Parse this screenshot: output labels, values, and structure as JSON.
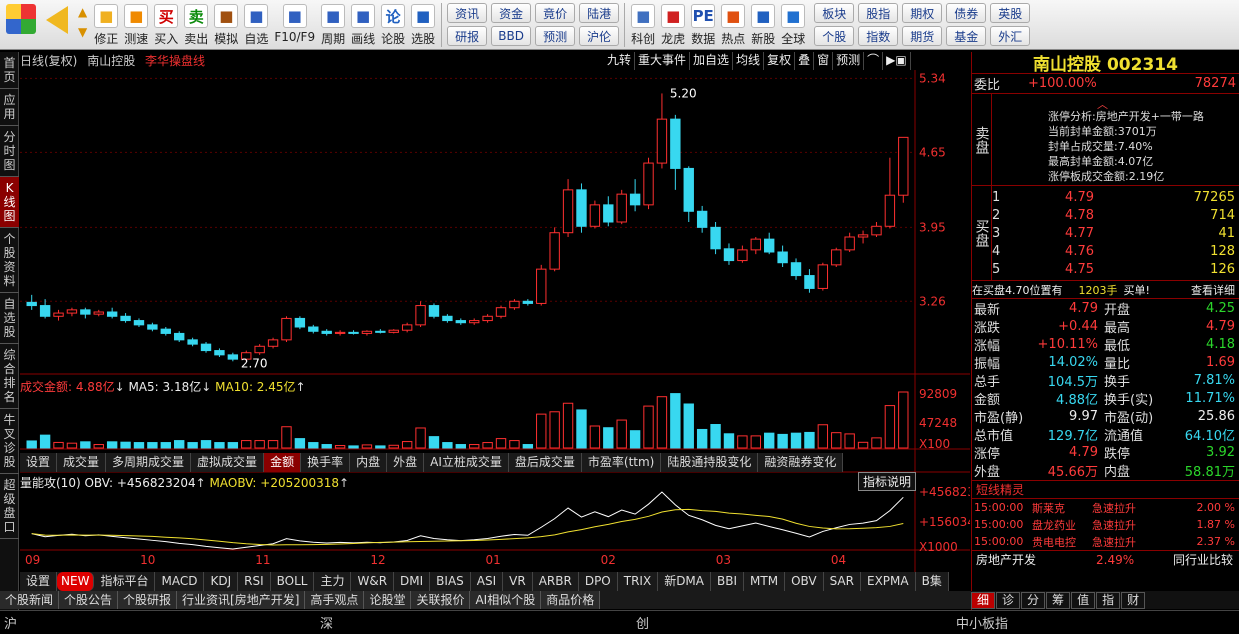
{
  "toolbar": {
    "buttons": [
      {
        "label": "修正",
        "icon": "refresh-icon",
        "color": "#f0b020"
      },
      {
        "label": "测速",
        "icon": "clock-icon",
        "color": "#f08a00"
      },
      {
        "label": "买入",
        "icon": "buy-icon",
        "glyph": "买",
        "color": "#d00000"
      },
      {
        "label": "卖出",
        "icon": "sell-icon",
        "glyph": "卖",
        "color": "#0a8a0a"
      },
      {
        "label": "模拟",
        "icon": "hammer-icon",
        "color": "#a05010"
      },
      {
        "label": "自选",
        "icon": "grid-icon",
        "color": "#3060c0"
      },
      {
        "label": "F10/F9",
        "icon": "window-icon",
        "color": "#3060c0"
      },
      {
        "label": "周期",
        "icon": "cycle-icon",
        "color": "#3060c0"
      },
      {
        "label": "画线",
        "icon": "pencil-icon",
        "color": "#3060c0"
      },
      {
        "label": "论股",
        "icon": "chat-icon",
        "glyph": "论",
        "color": "#2060c0"
      },
      {
        "label": "选股",
        "icon": "magnifier-icon",
        "color": "#2060c0"
      }
    ],
    "menu1": [
      "资讯",
      "资金",
      "竟价",
      "陆港",
      "研报",
      "BBD",
      "预测",
      "沪伦"
    ],
    "buttons2": [
      {
        "label": "科创",
        "icon": "chart-icon",
        "color": "#4070c0"
      },
      {
        "label": "龙虎",
        "icon": "dragon-icon",
        "color": "#d02020"
      },
      {
        "label": "数据",
        "icon": "pe-icon",
        "glyph": "PE",
        "color": "#2050b0"
      },
      {
        "label": "热点",
        "icon": "fire-icon",
        "color": "#e05010"
      },
      {
        "label": "新股",
        "icon": "new-stock-icon",
        "color": "#2060c0"
      },
      {
        "label": "全球",
        "icon": "globe-icon",
        "color": "#2070d0"
      }
    ],
    "menu2": [
      "板块",
      "股指",
      "期权",
      "债券",
      "英股",
      "个股",
      "指数",
      "期货",
      "基金",
      "外汇"
    ]
  },
  "sidetabs": [
    "首页",
    "应用",
    "分时图",
    "K线图",
    "个股资料",
    "自选股",
    "综合排名",
    "牛叉诊股",
    "超级盘口"
  ],
  "chart": {
    "header": [
      "日线(复权)",
      "南山控股",
      "李华操盘线"
    ],
    "tools": [
      "九转",
      "重大事件",
      "加自选",
      "均线",
      "复权",
      "叠",
      "窗",
      "预测",
      "⌒",
      "▶▣"
    ],
    "price_axis": [
      "5.34",
      "4.65",
      "3.95",
      "3.26"
    ],
    "high_label": "5.20",
    "low_label": "2.70",
    "vol_header": {
      "amount": "成交金额: 4.88亿",
      "ma5": "MA5: 3.18亿",
      "ma10": "MA10: 2.45亿"
    },
    "vol_axis": [
      "92809",
      "47248",
      "X100"
    ],
    "tabs1": [
      "设置",
      "成交量",
      "多周期成交量",
      "虚拟成交量",
      "金额",
      "换手率",
      "内盘",
      "外盘",
      "AI立桩成交量",
      "盘后成交量",
      "市盈率(ttm)",
      "陆股通持股变化",
      "融资融券变化"
    ],
    "obv_header": {
      "name": "量能攻(10)",
      "obv": "OBV: +456823204",
      "maobv": "MAOBV: +205200318"
    },
    "obv_button": "指标说明",
    "obv_axis": [
      "+456823",
      "+156034",
      "X1000"
    ],
    "months": [
      "09",
      "10",
      "11",
      "12",
      "01",
      "02",
      "03",
      "04"
    ],
    "tabs2": [
      "设置",
      "NEW",
      "指标平台",
      "MACD",
      "KDJ",
      "RSI",
      "BOLL",
      "主力",
      "W&R",
      "DMI",
      "BIAS",
      "ASI",
      "VR",
      "ARBR",
      "DPO",
      "TRIX",
      "新DMA",
      "BBI",
      "MTM",
      "OBV",
      "SAR",
      "EXPMA",
      "B集"
    ]
  },
  "chart_data": {
    "type": "candlestick",
    "note_free": true,
    "ohlc": [
      [
        3.25,
        3.32,
        3.18,
        3.22
      ],
      [
        3.22,
        3.28,
        3.1,
        3.12
      ],
      [
        3.12,
        3.18,
        3.08,
        3.15
      ],
      [
        3.15,
        3.2,
        3.12,
        3.18
      ],
      [
        3.18,
        3.2,
        3.1,
        3.14
      ],
      [
        3.14,
        3.18,
        3.12,
        3.16
      ],
      [
        3.16,
        3.2,
        3.1,
        3.12
      ],
      [
        3.12,
        3.15,
        3.06,
        3.08
      ],
      [
        3.08,
        3.1,
        3.02,
        3.04
      ],
      [
        3.04,
        3.06,
        2.98,
        3.0
      ],
      [
        3.0,
        3.02,
        2.94,
        2.96
      ],
      [
        2.96,
        2.98,
        2.88,
        2.9
      ],
      [
        2.9,
        2.92,
        2.84,
        2.86
      ],
      [
        2.86,
        2.88,
        2.78,
        2.8
      ],
      [
        2.8,
        2.82,
        2.74,
        2.76
      ],
      [
        2.76,
        2.78,
        2.7,
        2.72
      ],
      [
        2.72,
        2.8,
        2.7,
        2.78
      ],
      [
        2.78,
        2.86,
        2.76,
        2.84
      ],
      [
        2.84,
        2.92,
        2.82,
        2.9
      ],
      [
        2.9,
        3.12,
        2.88,
        3.1
      ],
      [
        3.1,
        3.12,
        3.0,
        3.02
      ],
      [
        3.02,
        3.04,
        2.96,
        2.98
      ],
      [
        2.98,
        3.0,
        2.94,
        2.96
      ],
      [
        2.96,
        2.99,
        2.94,
        2.97
      ],
      [
        2.97,
        2.99,
        2.95,
        2.96
      ],
      [
        2.96,
        2.99,
        2.94,
        2.98
      ],
      [
        2.98,
        3.0,
        2.96,
        2.97
      ],
      [
        2.97,
        3.0,
        2.96,
        2.99
      ],
      [
        2.99,
        3.06,
        2.97,
        3.04
      ],
      [
        3.04,
        3.26,
        3.02,
        3.22
      ],
      [
        3.22,
        3.24,
        3.1,
        3.12
      ],
      [
        3.12,
        3.14,
        3.06,
        3.08
      ],
      [
        3.08,
        3.1,
        3.04,
        3.06
      ],
      [
        3.06,
        3.1,
        3.04,
        3.08
      ],
      [
        3.08,
        3.14,
        3.06,
        3.12
      ],
      [
        3.12,
        3.22,
        3.1,
        3.2
      ],
      [
        3.2,
        3.28,
        3.18,
        3.26
      ],
      [
        3.26,
        3.28,
        3.22,
        3.24
      ],
      [
        3.24,
        3.6,
        3.22,
        3.56
      ],
      [
        3.56,
        3.95,
        3.54,
        3.9
      ],
      [
        3.9,
        4.4,
        3.86,
        4.3
      ],
      [
        4.3,
        4.36,
        3.9,
        3.96
      ],
      [
        3.96,
        4.2,
        3.94,
        4.16
      ],
      [
        4.16,
        4.24,
        3.96,
        4.0
      ],
      [
        4.0,
        4.3,
        3.98,
        4.26
      ],
      [
        4.26,
        4.4,
        4.1,
        4.16
      ],
      [
        4.16,
        4.6,
        4.12,
        4.55
      ],
      [
        4.55,
        5.2,
        4.5,
        4.96
      ],
      [
        4.96,
        5.0,
        4.3,
        4.5
      ],
      [
        4.5,
        4.52,
        4.0,
        4.1
      ],
      [
        4.1,
        4.15,
        3.9,
        3.95
      ],
      [
        3.95,
        4.0,
        3.7,
        3.75
      ],
      [
        3.75,
        3.8,
        3.6,
        3.64
      ],
      [
        3.64,
        3.78,
        3.62,
        3.74
      ],
      [
        3.74,
        3.86,
        3.7,
        3.84
      ],
      [
        3.84,
        3.9,
        3.7,
        3.72
      ],
      [
        3.72,
        3.78,
        3.58,
        3.62
      ],
      [
        3.62,
        3.66,
        3.46,
        3.5
      ],
      [
        3.5,
        3.56,
        3.34,
        3.38
      ],
      [
        3.38,
        3.62,
        3.36,
        3.6
      ],
      [
        3.6,
        3.76,
        3.58,
        3.74
      ],
      [
        3.74,
        3.9,
        3.72,
        3.86
      ],
      [
        3.86,
        3.92,
        3.8,
        3.88
      ],
      [
        3.88,
        4.0,
        3.86,
        3.96
      ],
      [
        3.96,
        4.6,
        3.94,
        4.25
      ],
      [
        4.25,
        4.79,
        4.18,
        4.79
      ]
    ],
    "price_ylim": [
      2.6,
      5.4
    ],
    "obv_ylim": [
      100000000,
      500000000
    ]
  },
  "right": {
    "title": "南山控股 002314",
    "weibi_label": "委比",
    "weibi": "+100.00%",
    "weicha": "78274",
    "sell_label": "卖盘",
    "buy_label": "买盘",
    "zt_info": [
      "涨停分析:房地产开发+一带一路",
      "当前封单金额:3701万",
      "封单占成交量:7.40%",
      "最高封单金额:4.07亿",
      "涨停板成交金额:2.19亿"
    ],
    "bids": [
      [
        "1",
        "4.79",
        "77265"
      ],
      [
        "2",
        "4.78",
        "714"
      ],
      [
        "3",
        "4.77",
        "41"
      ],
      [
        "4",
        "4.76",
        "128"
      ],
      [
        "5",
        "4.75",
        "126"
      ]
    ],
    "zaimai": "在买盘4.70位置有",
    "zaimai_num": "1203手",
    "zaimai_suffix": "买单!",
    "detail_link": "查看详细",
    "quotes": [
      [
        "最新",
        "4.79",
        "red",
        "开盘",
        "4.25",
        "grn"
      ],
      [
        "涨跌",
        "+0.44",
        "red",
        "最高",
        "4.79",
        "red"
      ],
      [
        "涨幅",
        "+10.11%",
        "red",
        "最低",
        "4.18",
        "grn"
      ],
      [
        "振幅",
        "14.02%",
        "cyn",
        "量比",
        "1.69",
        "red"
      ],
      [
        "总手",
        "104.5万",
        "cyn",
        "换手",
        "7.81%",
        "cyn"
      ],
      [
        "金额",
        "4.88亿",
        "cyn",
        "换手(实)",
        "11.71%",
        "cyn"
      ],
      [
        "市盈(静)",
        "9.97",
        "wht",
        "市盈(动)",
        "25.86",
        "wht"
      ],
      [
        "总市值",
        "129.7亿",
        "cyn",
        "流通值",
        "64.10亿",
        "cyn"
      ],
      [
        "涨停",
        "4.79",
        "red",
        "跌停",
        "3.92",
        "grn"
      ],
      [
        "外盘",
        "45.66万",
        "red",
        "内盘",
        "58.81万",
        "grn"
      ]
    ],
    "short_title": "短线精灵",
    "short_items": [
      [
        "15:00:00",
        "斯莱克",
        "急速拉升",
        "2.00 %"
      ],
      [
        "15:00:00",
        "盘龙药业",
        "急速拉升",
        "1.87 %"
      ],
      [
        "15:00:00",
        "贵电电控",
        "急速拉升",
        "2.37 %"
      ]
    ],
    "sector": "房地产开发",
    "sector_pct": "2.49%",
    "compare": "同行业比较",
    "sub_tabs": [
      "细",
      "诊",
      "分",
      "筹",
      "值",
      "指",
      "财"
    ]
  },
  "bottom_tabs": [
    "个股新闻",
    "个股公告",
    "个股研报",
    "行业资讯[房地产开发]",
    "高手观点",
    "论股堂",
    "关联报价",
    "AI相似个股",
    "商品价格"
  ],
  "status": {
    "sh": "沪",
    "sz": "深",
    "cy": "创",
    "zx": "中小板指"
  }
}
